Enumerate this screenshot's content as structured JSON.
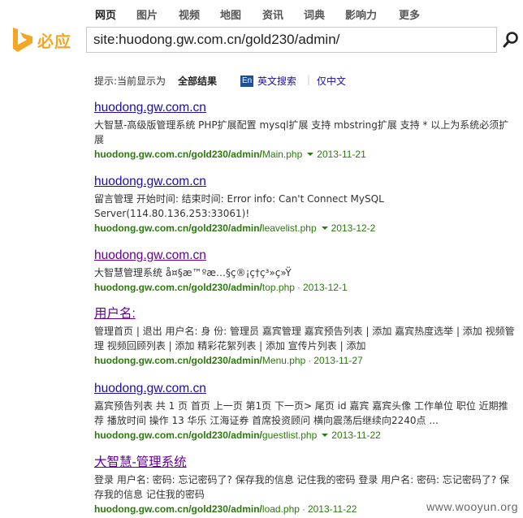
{
  "nav": {
    "items": [
      "网页",
      "图片",
      "视频",
      "地图",
      "资讯",
      "词典",
      "影响力",
      "更多"
    ],
    "active_index": 0
  },
  "logo": {
    "text": "必应",
    "icon": "bing-b-icon",
    "color": "#f5a623"
  },
  "search": {
    "query": "site:huodong.gw.com.cn/gold230/admin/",
    "button_icon": "search-icon"
  },
  "hint": {
    "prefix": "提示:当前显示为",
    "all_results": "全部结果",
    "en_badge": "En",
    "english_search": "英文搜索",
    "sep": "|",
    "chinese_only": "仅中文"
  },
  "results": [
    {
      "title": "huodong.gw.com.cn",
      "snippet": "大智慧-高级版管理系统 PHP扩展配置 mysql扩展 支持 mbstring扩展 支持 * 以上为系统必须扩展",
      "url_base": "huodong.gw.com.cn/gold230/admin/",
      "url_page": "Main.php",
      "date": "2013-11-21"
    },
    {
      "title": "huodong.gw.com.cn",
      "snippet": "留言管理 开始时间: 结束时间: Error info: Can't Connect MySQL Server(114.80.136.253:33061)!",
      "url_base": "huodong.gw.com.cn/gold230/admin/",
      "url_page": "leavelist.php",
      "date": "2013-12-2"
    },
    {
      "title": "huodong.gw.com.cn",
      "snippet": "大智慧管理系统 å¤§æ™ºæ…§ç®¡ç†ç³»ç»Ÿ",
      "url_base": "huodong.gw.com.cn/gold230/admin/",
      "url_page": "top.php",
      "date": "2013-12-1"
    },
    {
      "title": "用户名:",
      "snippet": "管理首页 | 退出 用户名: 身 份: 管理员 嘉宾管理 嘉宾预告列表 | 添加 嘉宾热度选举 | 添加 视频管理 视频回顾列表 | 添加 精彩花絮列表 | 添加 宣传片列表 | 添加",
      "url_base": "huodong.gw.com.cn/gold230/admin/",
      "url_page": "Menu.php",
      "date": "2013-11-27"
    },
    {
      "title": "huodong.gw.com.cn",
      "snippet": "嘉宾预告列表 共 1 页 首页 上一页 第1页 下一页> 尾页 id 嘉宾 嘉宾头像 工作单位 职位 近期推荐 播放时间 操作 13 华乐 江海证券 首席投资顾问 横向震荡后继续向2240点 ...",
      "url_base": "huodong.gw.com.cn/gold230/admin/",
      "url_page": "guestlist.php",
      "date": "2013-11-22"
    },
    {
      "title": "大智慧-管理系统",
      "snippet": "登录 用户名: 密码: 忘记密码了? 保存我的信息 记住我的密码 登录 用户名: 密码: 忘记密码了? 保存我的信息 记住我的密码",
      "url_base": "huodong.gw.com.cn/gold230/admin/",
      "url_page": "load.php",
      "date": "2013-11-22"
    }
  ],
  "watermark": "www.wooyun.org"
}
